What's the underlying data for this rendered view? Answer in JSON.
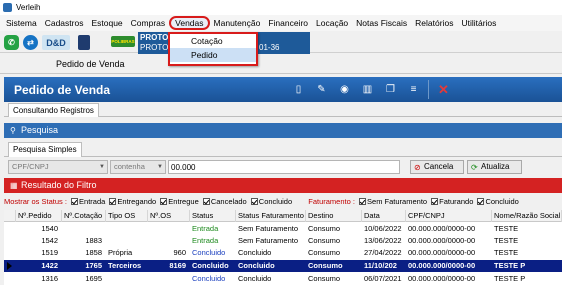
{
  "window": {
    "title": "Verleih"
  },
  "menu": {
    "items": [
      "Sistema",
      "Cadastros",
      "Estoque",
      "Compras",
      "Vendas",
      "Manutenção",
      "Financeiro",
      "Locação",
      "Notas Fiscais",
      "Relatórios",
      "Utilitários"
    ],
    "highlighted": "Vendas",
    "dropdown": [
      "Cotação",
      "Pedido"
    ]
  },
  "toolbar": {
    "dd_logo_text": "D&D",
    "brand_text": "POLIBRAS",
    "proto_line1": "PROTO",
    "proto_line2": "PROTOT",
    "proto_number": "01-36"
  },
  "form": {
    "tab_label": "Pedido de Venda",
    "title": "Pedido de Venda",
    "subtab": "Consultando Registros"
  },
  "search": {
    "section_title": "Pesquisa",
    "tab": "Pesquisa Simples",
    "field_combo": "CPF/CNPJ",
    "operator_combo": "contenha",
    "value": "00.000",
    "cancel_label": "Cancela",
    "update_label": "Atualiza"
  },
  "results": {
    "section_title": "Resultado do Filtro",
    "status_label": "Mostrar os Status :",
    "status_options": [
      "Entrada",
      "Entregando",
      "Entregue",
      "Cancelado",
      "Concluido"
    ],
    "billing_label": "Faturamento :",
    "billing_options": [
      "Sem Faturamento",
      "Faturando",
      "Concluido"
    ],
    "columns": [
      "Nº.Pedido",
      "Nº.Cotação",
      "Tipo OS",
      "Nº.OS",
      "Status",
      "Status Faturamento",
      "Destino",
      "Data",
      "CPF/CNPJ",
      "Nome/Razão Social"
    ],
    "rows": [
      {
        "pedido": "1540",
        "cotacao": "",
        "tipo": "",
        "os": "",
        "status": "Entrada",
        "fat": "Sem Faturamento",
        "destino": "Consumo",
        "data": "10/06/2022",
        "cpf": "00.000.000/0000-00",
        "nome": "TESTE"
      },
      {
        "pedido": "1542",
        "cotacao": "1883",
        "tipo": "",
        "os": "",
        "status": "Entrada",
        "fat": "Sem Faturamento",
        "destino": "Consumo",
        "data": "13/06/2022",
        "cpf": "00.000.000/0000-00",
        "nome": "TESTE"
      },
      {
        "pedido": "1519",
        "cotacao": "1858",
        "tipo": "Própria",
        "os": "960",
        "status": "Concluido",
        "fat": "Concluido",
        "destino": "Consumo",
        "data": "27/04/2022",
        "cpf": "00.000.000/0000-00",
        "nome": "TESTE"
      },
      {
        "pedido": "1422",
        "cotacao": "1765",
        "tipo": "Terceiros",
        "os": "8169",
        "status": "Concluido",
        "fat": "Concluido",
        "destino": "Consumo",
        "data": "11/10/202",
        "cpf": "00.000.000/0000-00",
        "nome": "TESTE P"
      },
      {
        "pedido": "1316",
        "cotacao": "1695",
        "tipo": "",
        "os": "",
        "status": "Concluido",
        "fat": "Concluido",
        "destino": "Consumo",
        "data": "06/07/2021",
        "cpf": "00.000.000/0000-00",
        "nome": "TESTE P"
      }
    ]
  },
  "colors": {
    "header_blue": "#1f5fa8",
    "section_red": "#d42222",
    "selected_row": "#0a1f84",
    "status_green": "#1e8a1e",
    "status_blue": "#1a3fbf",
    "highlight_outline": "#d81b1b"
  }
}
